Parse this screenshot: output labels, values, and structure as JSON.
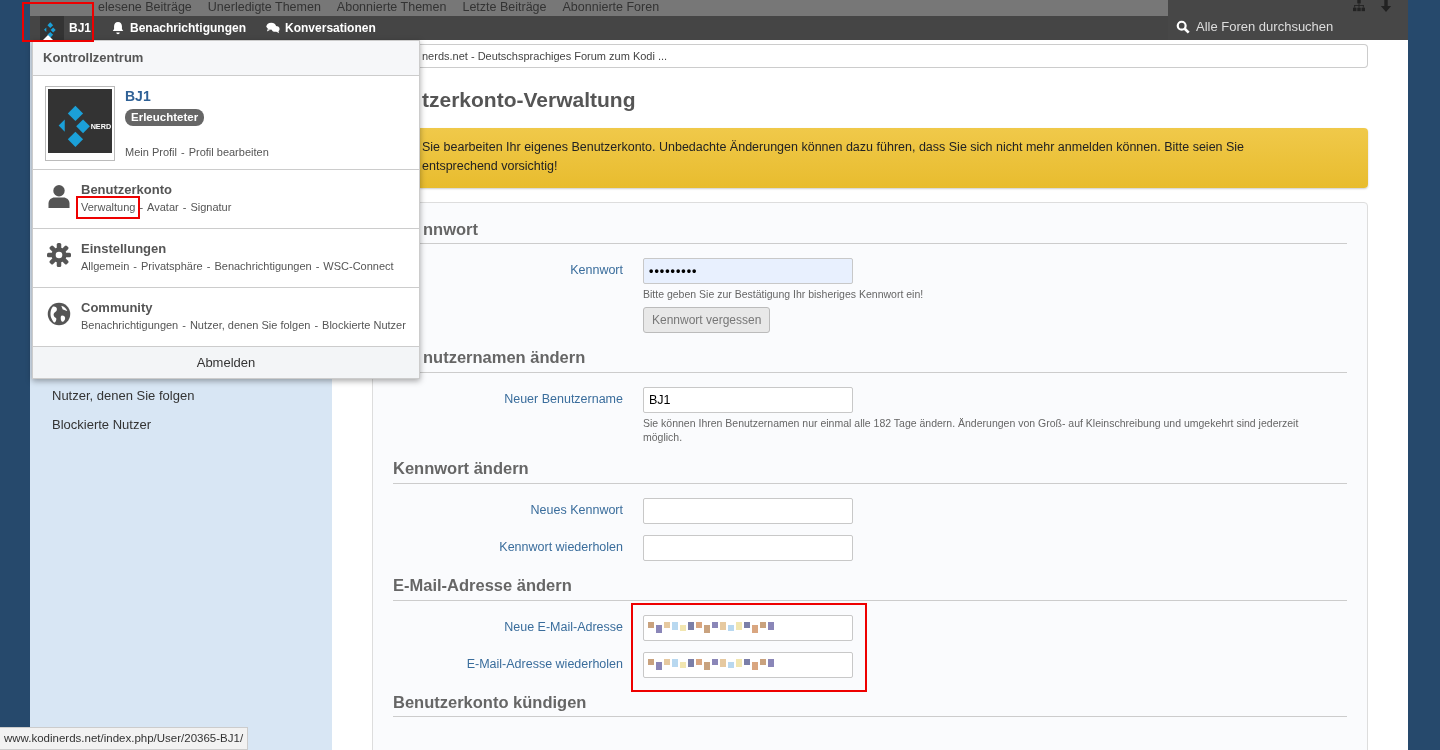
{
  "top_nav": {
    "links": [
      "elesene Beiträge",
      "Unerledigte Themen",
      "Abonnierte Themen",
      "Letzte Beiträge",
      "Abonnierte Foren"
    ]
  },
  "user_bar": {
    "user": "BJ1",
    "highlighted": true,
    "items": [
      {
        "kind": "bell",
        "label": "Benachrichtigungen"
      },
      {
        "kind": "comments",
        "label": "Konversationen"
      }
    ]
  },
  "search": {
    "placeholder": "Alle Foren durchsuchen"
  },
  "user_menu": {
    "title": "Kontrollzentrum",
    "profile": {
      "name": "BJ1",
      "rank": "Erleuchteter",
      "avatar_text": "NERD",
      "separator": "-",
      "links": [
        {
          "label": "Mein Profil",
          "highlighted": false
        },
        {
          "label": "Profil bearbeiten",
          "highlighted": false
        }
      ]
    },
    "sections": [
      {
        "kind": "user",
        "title": "Benutzerkonto",
        "separator": "-",
        "links": [
          {
            "label": "Verwaltung",
            "highlighted": true
          },
          {
            "label": "Avatar",
            "highlighted": false
          },
          {
            "label": "Signatur",
            "highlighted": false
          }
        ]
      },
      {
        "kind": "gear",
        "title": "Einstellungen",
        "separator": "-",
        "links": [
          {
            "label": "Allgemein",
            "highlighted": false
          },
          {
            "label": "Privatsphäre",
            "highlighted": false
          },
          {
            "label": "Benachrichtigungen",
            "highlighted": false
          },
          {
            "label": "WSC-Connect",
            "highlighted": false
          }
        ]
      },
      {
        "kind": "globe",
        "title": "Community",
        "separator": "-",
        "links": [
          {
            "label": "Benachrichtigungen",
            "highlighted": false
          },
          {
            "label": "Nutzer, denen Sie folgen",
            "highlighted": false
          },
          {
            "label": "Blockierte Nutzer",
            "highlighted": false
          }
        ]
      }
    ],
    "logout": "Abmelden"
  },
  "sidebar": {
    "items": [
      "Nutzer, denen Sie folgen",
      "Blockierte Nutzer"
    ]
  },
  "breadcrumb": "nerds.net - Deutschsprachiges Forum zum Kodi ...",
  "page_title": "tzerkonto-Verwaltung",
  "alert": {
    "lines": [
      "Sie bearbeiten Ihr eigenes Benutzerkonto. Unbedachte Änderungen können dazu führen, dass Sie sich nicht mehr anmelden können. Bitte seien Sie",
      "entsprechend vorsichtig!"
    ]
  },
  "form_sections": [
    {
      "title": "nnwort",
      "highlighted": false,
      "fields": [
        {
          "label": "Kennwort",
          "kind": "text",
          "value": "•••••••••",
          "autofilled": true,
          "help": {
            "before": "Bitte geben Sie zur Bestätigung Ihr ",
            "link": "bisheriges",
            "after": " Kennwort ein!"
          },
          "button": "Kennwort vergessen"
        }
      ]
    },
    {
      "title": "nutzernamen ändern",
      "highlighted": false,
      "fields": [
        {
          "label": "Neuer Benutzername",
          "kind": "text",
          "value": "BJ1",
          "autofilled": false,
          "help": {
            "before": "Sie können Ihren Benutzernamen nur einmal alle 182 Tage ändern. Änderungen von Groß- auf Kleinschreibung und umgekehrt sind jederzeit möglich."
          }
        }
      ]
    },
    {
      "title": "Kennwort ändern",
      "highlighted": false,
      "fields": [
        {
          "label": "Neues Kennwort",
          "kind": "text",
          "autofilled": false
        },
        {
          "label": "Kennwort wiederholen",
          "kind": "text",
          "autofilled": false
        }
      ]
    },
    {
      "title": "E-Mail-Adresse ändern",
      "highlighted": true,
      "fields": [
        {
          "label": "Neue E-Mail-Adresse",
          "kind": "redacted",
          "autofilled": false
        },
        {
          "label": "E-Mail-Adresse wiederholen",
          "kind": "redacted",
          "autofilled": false
        }
      ]
    },
    {
      "title": "Benutzerkonto kündigen",
      "highlighted": false
    }
  ],
  "status_url": "www.kodinerds.net/index.php/User/20365-BJ1/"
}
